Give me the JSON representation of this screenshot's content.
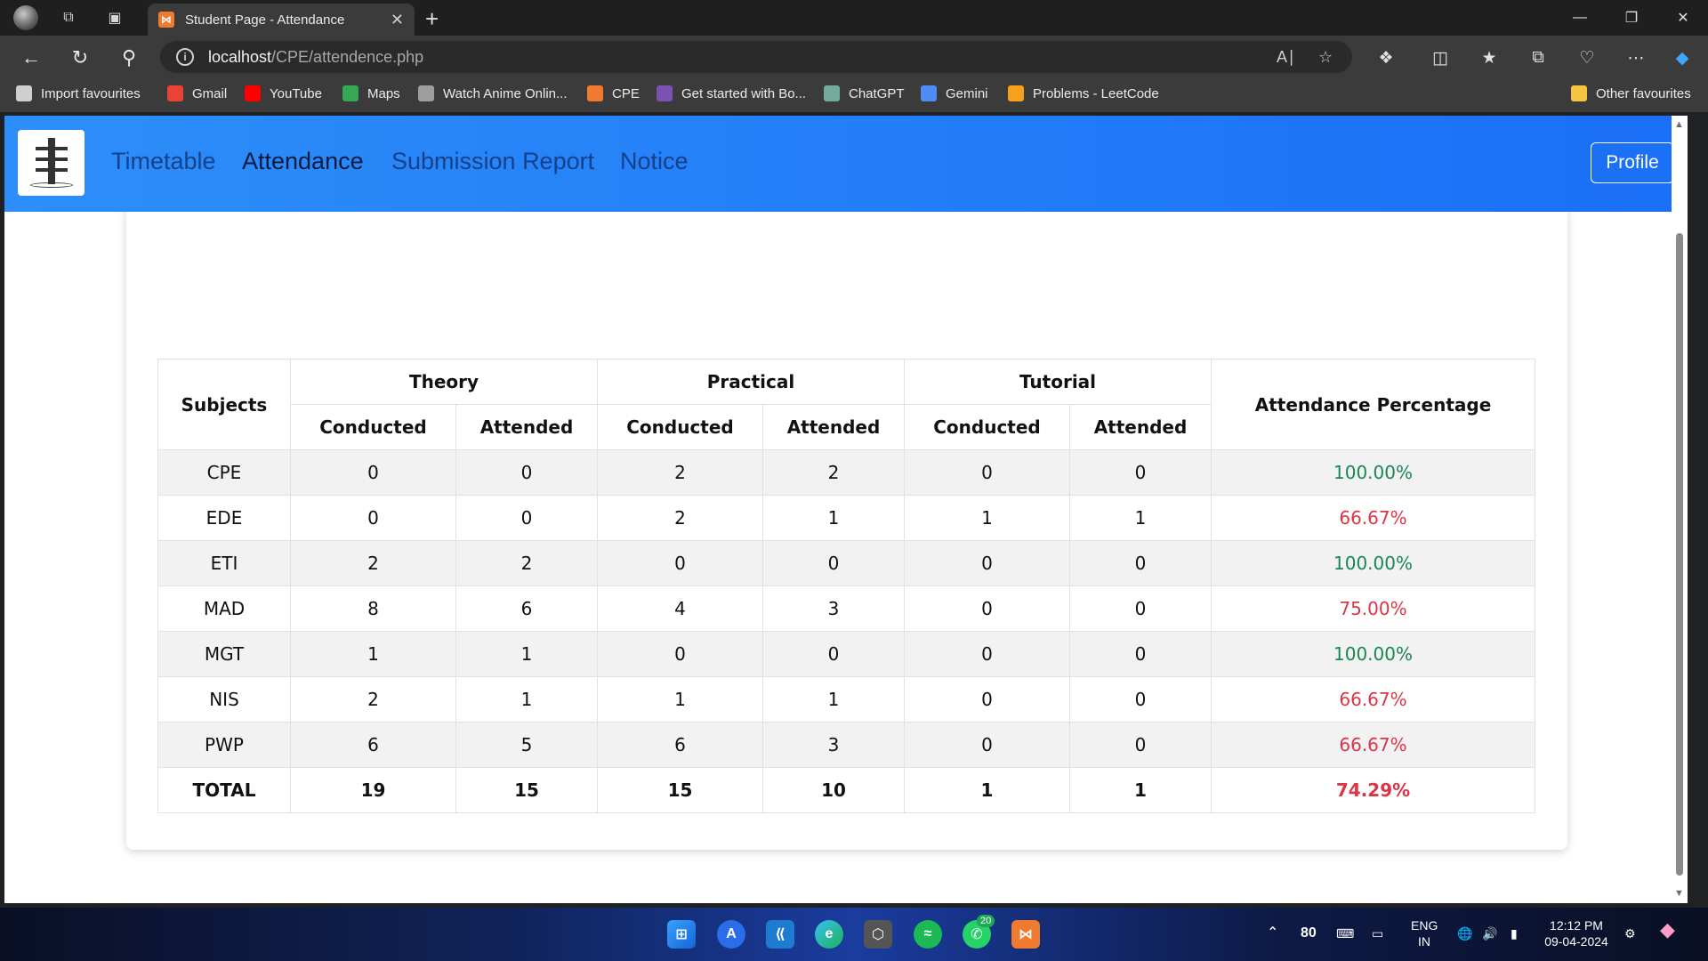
{
  "browser": {
    "tab_title": "Student Page - Attendance",
    "url_host": "localhost",
    "url_path": "/CPE/attendence.php",
    "favorites": [
      {
        "label": "Import favourites",
        "icon": "import-icon",
        "color": "#cfcfcf"
      },
      {
        "label": "Gmail",
        "icon": "gmail-icon",
        "color": "#ea4335"
      },
      {
        "label": "YouTube",
        "icon": "youtube-icon",
        "color": "#ff0000"
      },
      {
        "label": "Maps",
        "icon": "maps-icon",
        "color": "#34a853"
      },
      {
        "label": "Watch Anime Onlin...",
        "icon": "anime-icon",
        "color": "#9e9e9e"
      },
      {
        "label": "CPE",
        "icon": "xampp-icon",
        "color": "#f07a2f"
      },
      {
        "label": "Get started with Bo...",
        "icon": "bootstrap-icon",
        "color": "#7952b3"
      },
      {
        "label": "ChatGPT",
        "icon": "chatgpt-icon",
        "color": "#74aa9c"
      },
      {
        "label": "Gemini",
        "icon": "gemini-icon",
        "color": "#4f8cf7"
      },
      {
        "label": "Problems - LeetCode",
        "icon": "leetcode-icon",
        "color": "#f89f1b"
      }
    ],
    "other_favourites": "Other favourites"
  },
  "nav": {
    "links": [
      "Timetable",
      "Attendance",
      "Submission Report",
      "Notice"
    ],
    "active": "Attendance",
    "profile_label": "Profile"
  },
  "table": {
    "headers": {
      "subjects": "Subjects",
      "theory": "Theory",
      "practical": "Practical",
      "tutorial": "Tutorial",
      "conducted": "Conducted",
      "attended": "Attended",
      "percentage": "Attendance Percentage"
    },
    "rows": [
      {
        "subject": "CPE",
        "values": [
          "0",
          "0",
          "2",
          "2",
          "0",
          "0"
        ],
        "percentage": "100.00%",
        "status": "good"
      },
      {
        "subject": "EDE",
        "values": [
          "0",
          "0",
          "2",
          "1",
          "1",
          "1"
        ],
        "percentage": "66.67%",
        "status": "bad"
      },
      {
        "subject": "ETI",
        "values": [
          "2",
          "2",
          "0",
          "0",
          "0",
          "0"
        ],
        "percentage": "100.00%",
        "status": "good"
      },
      {
        "subject": "MAD",
        "values": [
          "8",
          "6",
          "4",
          "3",
          "0",
          "0"
        ],
        "percentage": "75.00%",
        "status": "bad"
      },
      {
        "subject": "MGT",
        "values": [
          "1",
          "1",
          "0",
          "0",
          "0",
          "0"
        ],
        "percentage": "100.00%",
        "status": "good"
      },
      {
        "subject": "NIS",
        "values": [
          "2",
          "1",
          "1",
          "1",
          "0",
          "0"
        ],
        "percentage": "66.67%",
        "status": "bad"
      },
      {
        "subject": "PWP",
        "values": [
          "6",
          "5",
          "6",
          "3",
          "0",
          "0"
        ],
        "percentage": "66.67%",
        "status": "bad"
      }
    ],
    "total": {
      "subject": "TOTAL",
      "values": [
        "19",
        "15",
        "15",
        "10",
        "1",
        "1"
      ],
      "percentage": "74.29%",
      "status": "bad"
    },
    "colors": {
      "good": "#198754",
      "bad": "#dc3545"
    }
  },
  "taskbar": {
    "temperature": "80",
    "lang_line1": "ENG",
    "lang_line2": "IN",
    "time": "12:12 PM",
    "date": "09-04-2024",
    "whatsapp_badge": "20"
  }
}
